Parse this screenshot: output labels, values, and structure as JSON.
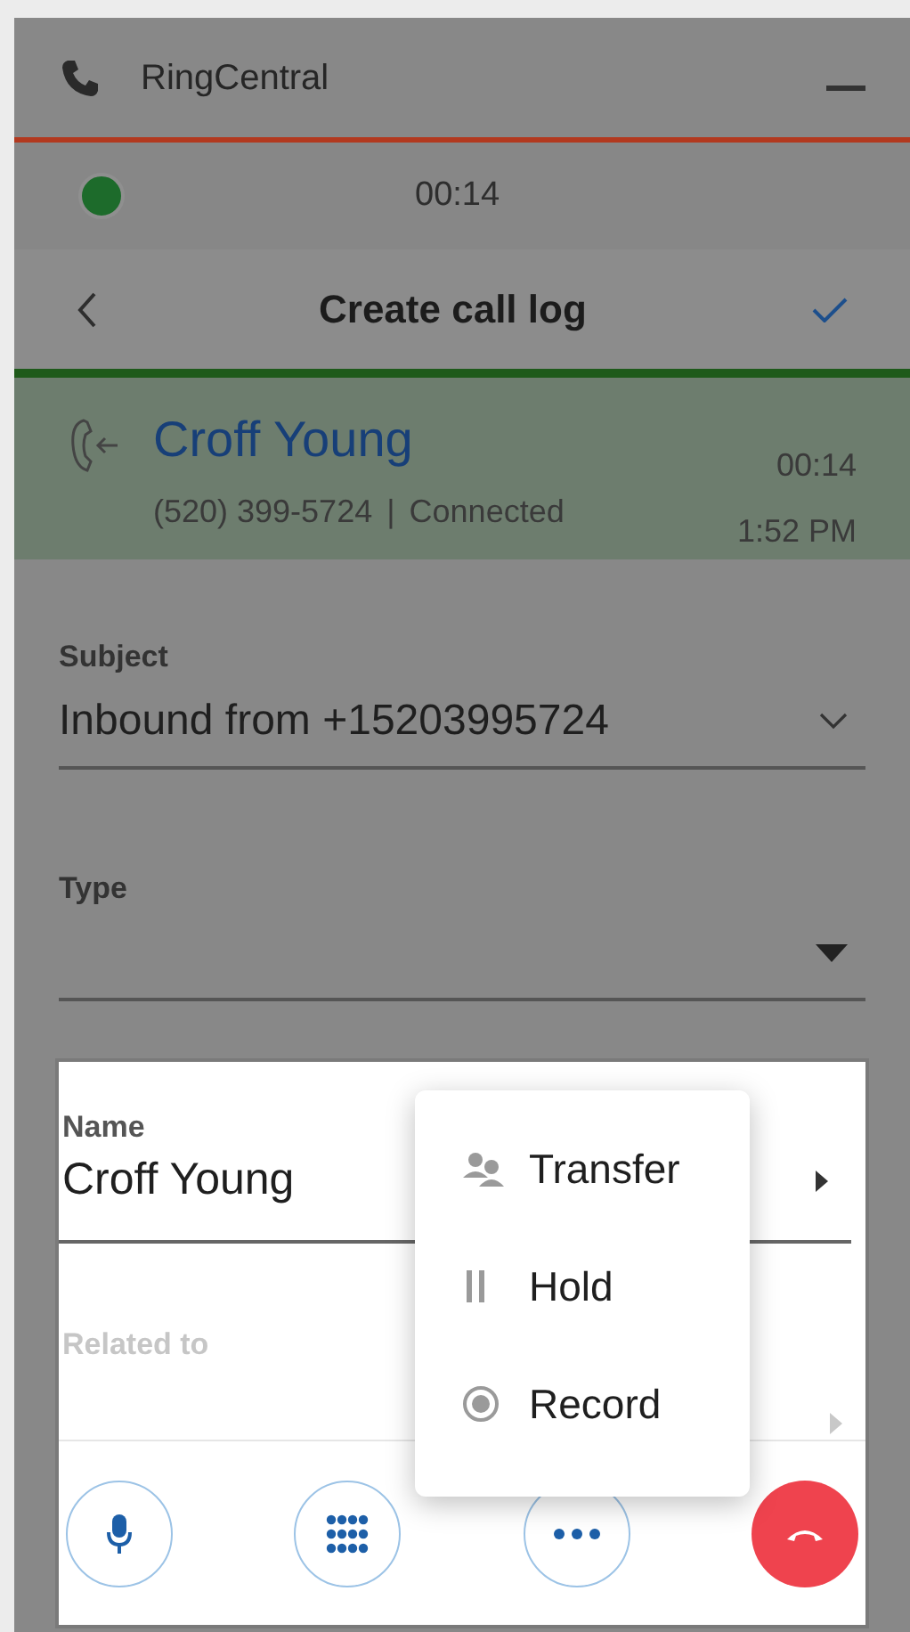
{
  "window": {
    "title": "RingCentral"
  },
  "call_timer": "00:14",
  "header": {
    "title": "Create call log"
  },
  "call": {
    "name": "Croff Young",
    "number": "(520) 399-5724",
    "separator": "|",
    "status": "Connected",
    "duration": "00:14",
    "time": "1:52 PM"
  },
  "fields": [
    {
      "label": "Subject",
      "value": "Inbound from +15203995724",
      "kind": "select"
    },
    {
      "label": "Type",
      "kind": "dropdown"
    }
  ],
  "panel_fields": [
    {
      "label": "Name",
      "value": "Croff Young",
      "disabled": false
    },
    {
      "label": "Related to",
      "disabled": true
    }
  ],
  "menu": [
    {
      "label": "Transfer",
      "kind": "transfer"
    },
    {
      "label": "Hold",
      "kind": "hold"
    },
    {
      "label": "Record",
      "kind": "record"
    }
  ],
  "controls": [
    {
      "kind": "mute"
    },
    {
      "kind": "keypad"
    },
    {
      "kind": "more"
    },
    {
      "kind": "hangup"
    }
  ]
}
